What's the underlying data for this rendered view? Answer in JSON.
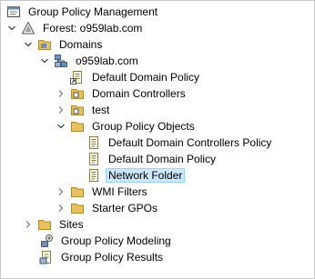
{
  "tree": {
    "root": {
      "label": "Group Policy Management",
      "icon": "gpm-console-icon"
    },
    "forest": {
      "label": "Forest: o959lab.com",
      "icon": "forest-icon",
      "expanded": true
    },
    "domains": {
      "label": "Domains",
      "icon": "folder-icon",
      "expanded": true
    },
    "domain": {
      "label": "o959lab.com",
      "icon": "domain-icon",
      "expanded": true
    },
    "default_domain_policy_link": {
      "label": "Default Domain Policy",
      "icon": "gpo-link-icon"
    },
    "domain_controllers": {
      "label": "Domain Controllers",
      "icon": "ou-folder-icon",
      "expanded": false
    },
    "test_ou": {
      "label": "test",
      "icon": "ou-folder-icon",
      "expanded": false
    },
    "gpo_container": {
      "label": "Group Policy Objects",
      "icon": "folder-icon",
      "expanded": true
    },
    "gpos": [
      {
        "label": "Default Domain Controllers Policy",
        "icon": "gpo-icon"
      },
      {
        "label": "Default Domain Policy",
        "icon": "gpo-icon"
      },
      {
        "label": "Network Folder",
        "icon": "gpo-icon",
        "selected": true
      }
    ],
    "wmi_filters": {
      "label": "WMI Filters",
      "icon": "folder-icon",
      "expanded": false
    },
    "starter_gpos": {
      "label": "Starter GPOs",
      "icon": "folder-icon",
      "expanded": false
    },
    "sites": {
      "label": "Sites",
      "icon": "folder-icon",
      "expanded": false
    },
    "modeling": {
      "label": "Group Policy Modeling",
      "icon": "modeling-icon"
    },
    "results": {
      "label": "Group Policy Results",
      "icon": "results-icon"
    }
  },
  "colors": {
    "selection_bg": "#cce8ff",
    "selection_border": "#99d1ff",
    "folder": "#e8c15a"
  }
}
